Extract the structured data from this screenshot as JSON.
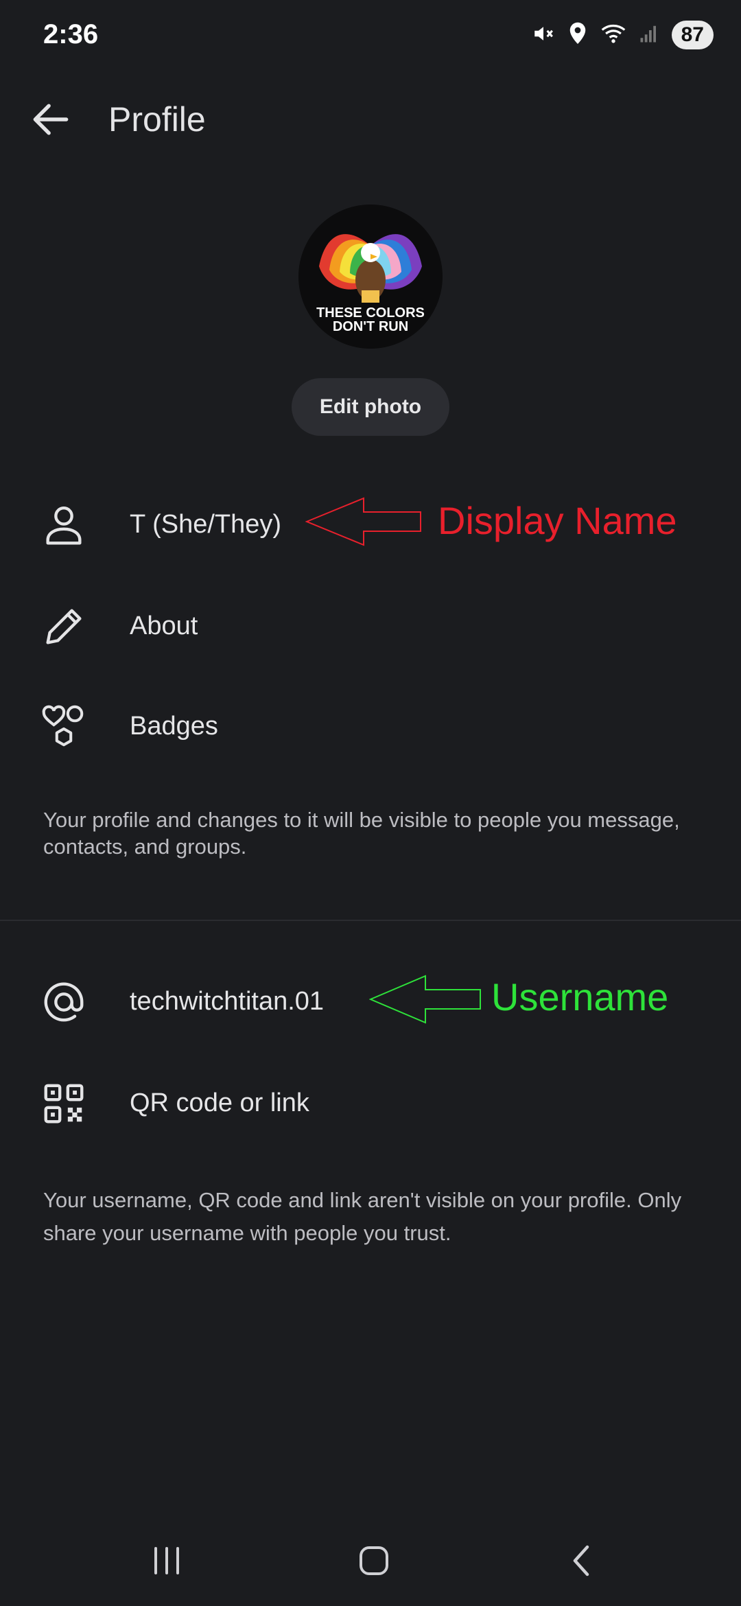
{
  "status_bar": {
    "time": "2:36",
    "battery": "87",
    "icons": [
      "mute-icon",
      "location-icon",
      "wifi-icon",
      "signal-icon",
      "battery-icon"
    ]
  },
  "app_bar": {
    "title": "Profile",
    "back_icon": "arrow-left-icon"
  },
  "avatar": {
    "lines": [
      "THESE COLORS",
      "DON'T RUN"
    ]
  },
  "edit_photo_label": "Edit photo",
  "profile_rows": [
    {
      "icon": "person-icon",
      "label": "T (She/They)"
    },
    {
      "icon": "pencil-icon",
      "label": "About"
    },
    {
      "icon": "badges-icon",
      "label": "Badges"
    }
  ],
  "profile_note": "Your profile and changes to it will be visible to people you message, contacts, and groups.",
  "username_rows": [
    {
      "icon": "at-sign-icon",
      "label": "techwitchtitan.01"
    },
    {
      "icon": "qr-code-icon",
      "label": "QR code or link"
    }
  ],
  "username_note": "Your username, QR code and link aren't visible on your profile. Only share your username with people you trust.",
  "annotations": {
    "display_name": "Display Name",
    "username": "Username"
  },
  "colors": {
    "background": "#1b1c1f",
    "annotation_red": "#e8202c",
    "annotation_green": "#2ee23a"
  },
  "nav_bar": [
    "recents-icon",
    "home-icon",
    "back-icon"
  ]
}
